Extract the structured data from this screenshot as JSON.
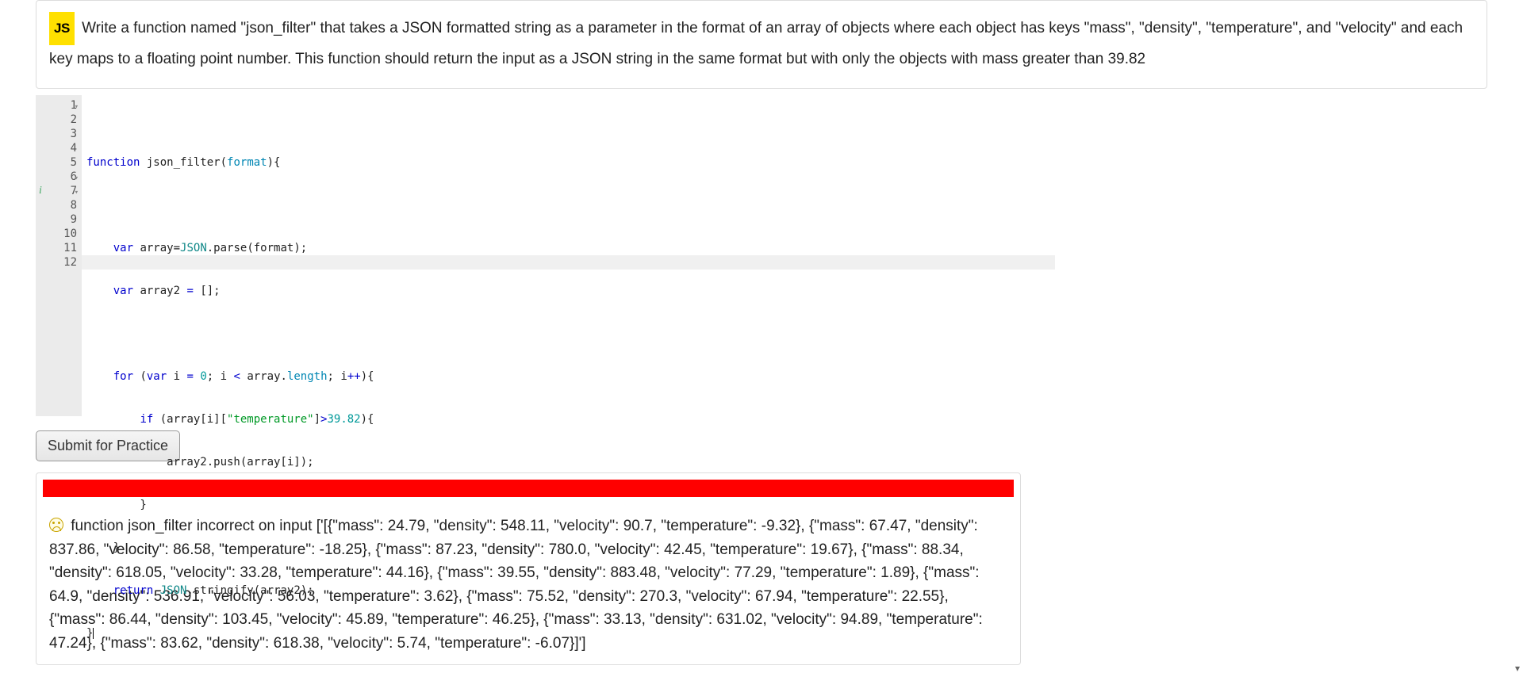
{
  "badge": {
    "text": "JS"
  },
  "problem": {
    "text_line1": "Write a function named \"json_filter\" that takes a JSON formatted string as a parameter in the format of an array of objects where each object has keys \"mass\", \"density\", \"temperature\", and",
    "text_line2": "\"velocity\" and each key maps to a floating point number. This function should return the input as a JSON string in the same format but with only the objects with mass greater than 39.82"
  },
  "editor": {
    "line_numbers": [
      "1",
      "2",
      "3",
      "4",
      "5",
      "6",
      "7",
      "8",
      "9",
      "10",
      "11",
      "12"
    ],
    "folds": {
      "1": true,
      "6": true,
      "7": true
    },
    "info_line": 7,
    "highlighted_line": 12,
    "code": {
      "l1_a": "function",
      "l1_b": " json_filter",
      "l1_c": "(",
      "l1_d": "format",
      "l1_e": "){",
      "l3_a": "    ",
      "l3_b": "var",
      "l3_c": " array=",
      "l3_d": "JSON",
      "l3_e": ".parse(format);",
      "l4_a": "    ",
      "l4_b": "var",
      "l4_c": " array2 ",
      "l4_d": "=",
      "l4_e": " [];",
      "l6_a": "    ",
      "l6_b": "for",
      "l6_c": " (",
      "l6_d": "var",
      "l6_e": " i ",
      "l6_f": "=",
      "l6_g": " ",
      "l6_h": "0",
      "l6_i": "; i ",
      "l6_j": "<",
      "l6_k": " array.",
      "l6_l": "length",
      "l6_m": "; i",
      "l6_n": "++",
      "l6_o": "){",
      "l7_a": "        ",
      "l7_b": "if",
      "l7_c": " (array[i][",
      "l7_d": "\"temperature\"",
      "l7_e": "]",
      "l7_f": ">",
      "l7_g": "39.82",
      "l7_h": "){",
      "l8_a": "            array2.push(array[i]);",
      "l9_a": "        }",
      "l10_a": "    }",
      "l11_a": "    ",
      "l11_b": "return",
      "l11_c": " ",
      "l11_d": "JSON",
      "l11_e": ".stringify(array2);",
      "l12_a": "}"
    }
  },
  "buttons": {
    "submit": "Submit for Practice"
  },
  "result": {
    "text": "function json_filter incorrect on input ['[{\"mass\": 24.79, \"density\": 548.11, \"velocity\": 90.7, \"temperature\": -9.32}, {\"mass\": 67.47, \"density\": 837.86, \"velocity\": 86.58, \"temperature\": -18.25}, {\"mass\": 87.23, \"density\": 780.0, \"velocity\": 42.45, \"temperature\": 19.67}, {\"mass\": 88.34, \"density\": 618.05, \"velocity\": 33.28, \"temperature\": 44.16}, {\"mass\": 39.55, \"density\": 883.48, \"velocity\": 77.29, \"temperature\": 1.89}, {\"mass\": 64.9, \"density\": 536.91, \"velocity\": 56.03, \"temperature\": 3.62}, {\"mass\": 75.52, \"density\": 270.3, \"velocity\": 67.94, \"temperature\": 22.55}, {\"mass\": 86.44, \"density\": 103.45, \"velocity\": 45.89, \"temperature\": 46.25}, {\"mass\": 33.13, \"density\": 631.02, \"velocity\": 94.89, \"temperature\": 47.24}, {\"mass\": 83.62, \"density\": 618.38, \"velocity\": 5.74, \"temperature\": -6.07}]']"
  }
}
